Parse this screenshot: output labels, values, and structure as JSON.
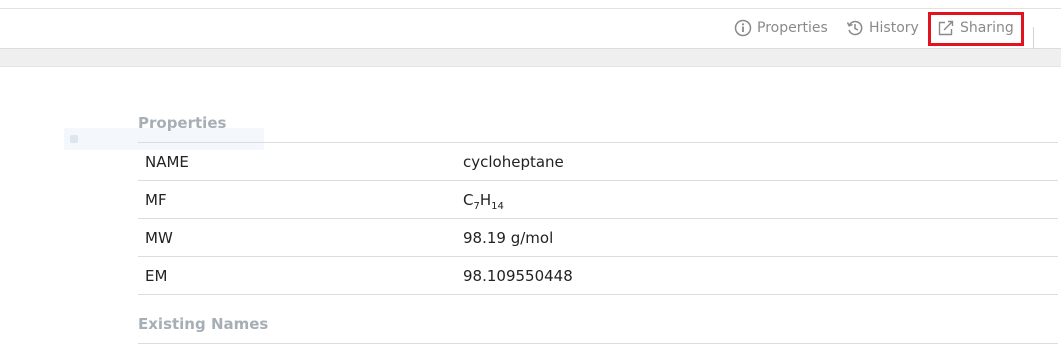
{
  "toolbar": {
    "properties_label": "Properties",
    "history_label": "History",
    "sharing_label": "Sharing"
  },
  "colors": {
    "highlight": "#e0141e",
    "muted_text": "#8a8a8a",
    "section_title": "#a6aeb6"
  },
  "sections": {
    "properties_title": "Properties",
    "existing_names_title": "Existing Names"
  },
  "properties": {
    "name": {
      "key": "NAME",
      "value": "cycloheptane"
    },
    "mf": {
      "key": "MF",
      "c": "C",
      "c_count": "7",
      "h": "H",
      "h_count": "14"
    },
    "mw": {
      "key": "MW",
      "value": "98.19 g/mol"
    },
    "em": {
      "key": "EM",
      "value": "98.109550448"
    }
  }
}
